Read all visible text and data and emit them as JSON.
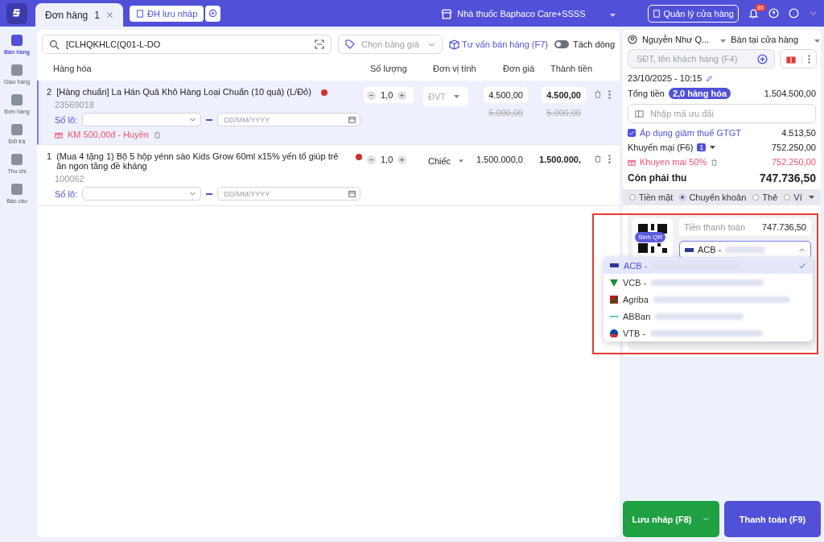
{
  "topbar": {
    "tabs": [
      {
        "label": "Đơn hàng",
        "count": "1",
        "selected": true
      }
    ],
    "draft_button": "ĐH lưu nháp",
    "store": "Nhà thuốc Baphaco Care+SSSS",
    "manage_button": "Quản lý cửa hàng",
    "notifications": "85"
  },
  "sidebar": {
    "items": [
      {
        "label": "Bán hàng",
        "selected": true
      },
      {
        "label": "Giao hàng",
        "selected": false
      },
      {
        "label": "Đơn hàng",
        "selected": false
      },
      {
        "label": "Đổi trả",
        "selected": false
      },
      {
        "label": "Thu chi",
        "selected": false
      },
      {
        "label": "Báo cáo",
        "selected": false
      }
    ]
  },
  "toolbar": {
    "search_value": "[CLHQKHLC(Q01-L-DO",
    "price_list_placeholder": "Chọn bảng giá",
    "advice_link": "Tư vấn bán hàng (F7)",
    "split_toggle": {
      "label": "Tách dòng",
      "on": false
    }
  },
  "table": {
    "columns": [
      "Hàng hóa",
      "Số lượng",
      "Đơn vị tính",
      "Đơn giá",
      "Thành tiền"
    ],
    "rows": [
      {
        "index": "2",
        "name": "[Hàng chuẩn] La Hán Quả Khô Hàng Loại Chuẩn (10 quả) (L/Đỏ)",
        "code": "23569018",
        "quantity": "1,0",
        "unit": "ĐVT",
        "unit_placeholder": true,
        "price": "4.500,00",
        "total": "4.500,00",
        "old_price": "5.000,00",
        "old_total": "5.000,00",
        "batch_label": "Số lô:",
        "date_placeholder": "DD/MM/YYYY",
        "promo": "KM 500,00đ - Huyền",
        "selected": true
      },
      {
        "index": "1",
        "name": "(Mua 4 tặng 1) Bộ 5 hộp yénn sào Kids Grow 60ml x15% yến tổ giúp trẻ ăn ngon tăng đề kháng",
        "code": "100062",
        "quantity": "1,0",
        "unit": "Chiếc",
        "unit_placeholder": false,
        "price": "1.500.000,0",
        "total": "1.500.000,",
        "batch_label": "Số lô:",
        "date_placeholder": "DD/MM/YYYY",
        "selected": false
      }
    ]
  },
  "order": {
    "customer": "Nguyễn Như Q...",
    "channel": "Bán tại cửa hàng",
    "phone_placeholder": "SĐT, tên khách hàng (F4)",
    "datetime": "23/10/2025 - 10:15",
    "total_label": "Tổng tiền",
    "item_count": "2,0 hàng hóa",
    "total": "1.504.500,00",
    "coupon_placeholder": "Nhập mã ưu đãi",
    "tax": {
      "label": "Áp dụng giảm thuế GTGT",
      "checked": true,
      "value": "4.513,50"
    },
    "promotions": {
      "label": "Khuyến mại (F6)",
      "count": "1",
      "value": "752.250,00",
      "items": [
        {
          "name": "Khuyen mai 50%",
          "value": "752.250,00"
        }
      ]
    },
    "due_label": "Còn phải thu",
    "due": "747.736,50",
    "payment_methods": [
      {
        "label": "Tiền mặt",
        "selected": false
      },
      {
        "label": "Chuyển khoản",
        "selected": true
      },
      {
        "label": "Thẻ",
        "selected": false
      },
      {
        "label": "Ví",
        "selected": false
      }
    ],
    "qr_button": "Sinh QR",
    "pay_label": "Tiền thanh toán",
    "pay_value": "747.736,50",
    "bank_select": "ACB -",
    "banks": [
      {
        "label": "ACB -",
        "selected": true
      },
      {
        "label": "VCB -",
        "selected": false
      },
      {
        "label": "Agriba",
        "selected": false
      },
      {
        "label": "ABBan",
        "selected": false
      },
      {
        "label": "VTB -",
        "selected": false
      }
    ],
    "save_button": "Lưu nháp (F8)",
    "pay_button": "Thanh toán (F9)"
  }
}
